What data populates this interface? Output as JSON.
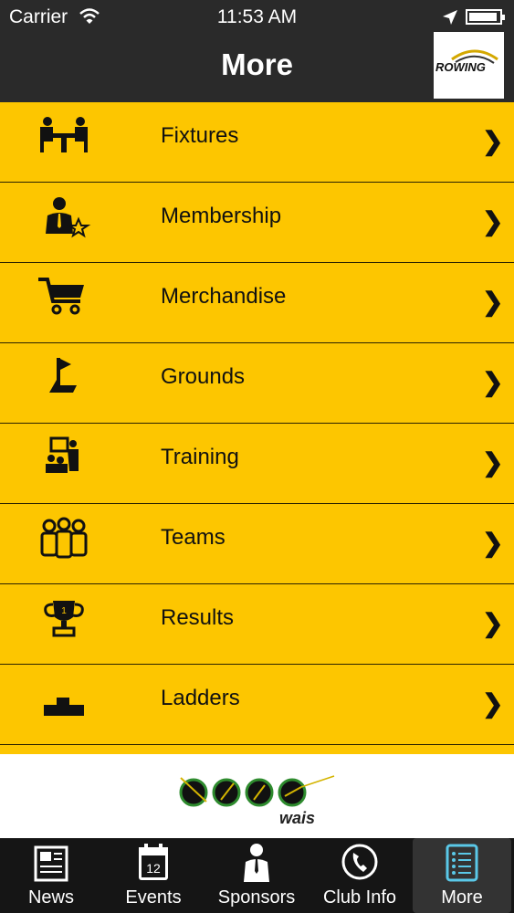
{
  "status_bar": {
    "carrier": "Carrier",
    "time": "11:53 AM",
    "battery_level": 0.95
  },
  "nav": {
    "title": "More",
    "logo_text": "ROWING"
  },
  "menu": [
    {
      "label": "Fixtures",
      "icon": "meeting-table-icon"
    },
    {
      "label": "Membership",
      "icon": "member-star-icon"
    },
    {
      "label": "Merchandise",
      "icon": "shopping-cart-icon"
    },
    {
      "label": "Grounds",
      "icon": "golf-flag-icon"
    },
    {
      "label": "Training",
      "icon": "presentation-icon"
    },
    {
      "label": "Teams",
      "icon": "team-group-icon"
    },
    {
      "label": "Results",
      "icon": "trophy-icon"
    },
    {
      "label": "Ladders",
      "icon": "podium-icon"
    }
  ],
  "chevron": "❯",
  "banner": {
    "text": "wais"
  },
  "tabs": [
    {
      "label": "News",
      "icon": "newspaper-icon"
    },
    {
      "label": "Events",
      "icon": "calendar-icon",
      "calendar_day": "12"
    },
    {
      "label": "Sponsors",
      "icon": "businessman-icon"
    },
    {
      "label": "Club Info",
      "icon": "phone-icon"
    },
    {
      "label": "More",
      "icon": "list-icon"
    }
  ],
  "colors": {
    "accent": "#fdc600",
    "bar": "#2a2a2a",
    "tabbar": "#151515"
  }
}
